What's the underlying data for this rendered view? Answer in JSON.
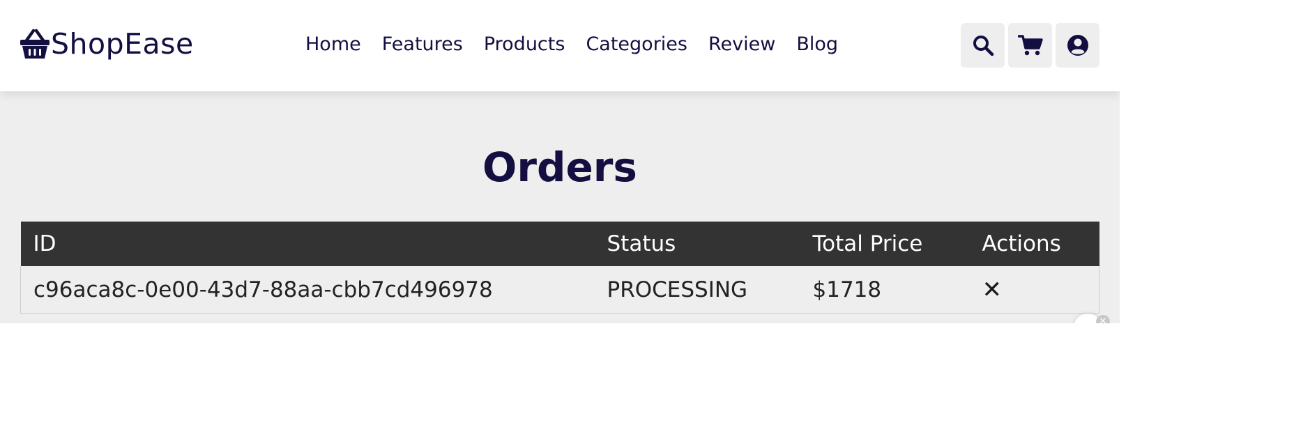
{
  "brand": {
    "name": "ShopEase",
    "icon": "basket-icon",
    "color": "#130f40"
  },
  "nav": [
    {
      "label": "Home"
    },
    {
      "label": "Features"
    },
    {
      "label": "Products"
    },
    {
      "label": "Categories"
    },
    {
      "label": "Review"
    },
    {
      "label": "Blog"
    }
  ],
  "header_icons": [
    "search-icon",
    "cart-icon",
    "user-circle-icon"
  ],
  "page": {
    "title": "Orders"
  },
  "orders_table": {
    "columns": [
      "ID",
      "Status",
      "Total Price",
      "Actions"
    ],
    "rows": [
      {
        "id": "c96aca8c-0e00-43d7-88aa-cbb7cd496978",
        "status": "PROCESSING",
        "total_price": "$1718",
        "action": "✕",
        "action_icon": "close-icon"
      }
    ]
  },
  "colors": {
    "brand": "#130f40",
    "table_header": "#333333",
    "content_background": "#eeeeee"
  }
}
